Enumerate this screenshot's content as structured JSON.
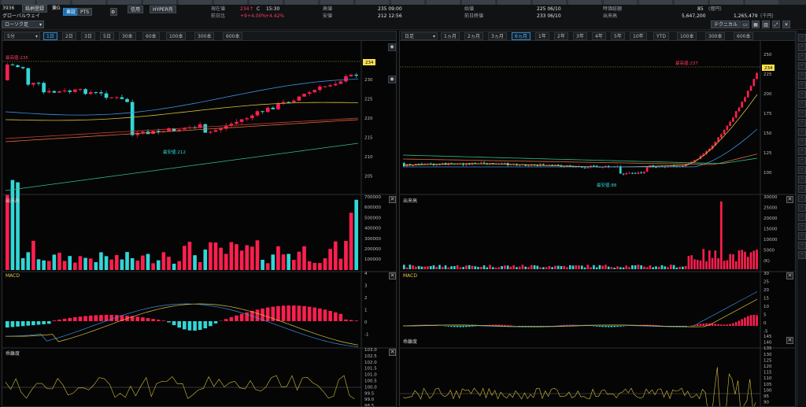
{
  "ticker": [
    "",
    "",
    "",
    "",
    "",
    "",
    "",
    "",
    "",
    "",
    "",
    "",
    "",
    "",
    "",
    "",
    "",
    "",
    "",
    "",
    "",
    ""
  ],
  "header": {
    "code": "3936",
    "name": "グローバルウェイ",
    "market_btn": "東G",
    "brand_btn": "銘柄登録",
    "tabs": [
      "東証",
      "PTS"
    ],
    "credit": "信用",
    "hyper": "HYPER売",
    "chart_type": "ローソク足",
    "labels": {
      "now": "現在値",
      "chg": "前日比",
      "high": "高値",
      "low": "安値",
      "open": "始値",
      "prev": "前日終値",
      "vol": "出来高",
      "val": "売買代金",
      "cap": "時価総額"
    },
    "values": {
      "now": "234",
      "now_mark": "↑",
      "c_label": "C",
      "time": "15:30",
      "chg": "+9",
      "chg_pct": "+4.00%",
      "chg_pct2": "+4.42%",
      "high": "235 09:00",
      "low": "212 12:56",
      "open": "225 06/10",
      "prev": "233 06/10",
      "vol": "5,647,200",
      "val": "1,265,479",
      "val_unit": "(千円)",
      "cap": "85",
      "cap_unit": "(億円)"
    },
    "technical": "テクニカル"
  },
  "left": {
    "interval": "5分",
    "tabs": [
      "1日",
      "2日",
      "3日",
      "5日",
      "30本",
      "60本",
      "100本",
      "300本",
      "600本"
    ],
    "active_tab": "1日",
    "price_tag": "234",
    "high_label": "最高値:235",
    "low_label": "最安値:212",
    "price_axis": [
      "230",
      "225",
      "220",
      "215",
      "210",
      "205"
    ],
    "vol_title": "出来高",
    "vol_axis": [
      "700000",
      "600000",
      "500000",
      "400000",
      "300000",
      "200000",
      "100000"
    ],
    "macd_title": "MACD",
    "macd_axis": [
      "4",
      "3",
      "2",
      "1",
      "0",
      "-1"
    ],
    "dev_title": "乖離度",
    "dev_axis": [
      "103.0",
      "102.5",
      "102.0",
      "101.5",
      "101.0",
      "100.5",
      "100.0",
      "99.5",
      "99.0",
      "98.5"
    ]
  },
  "right": {
    "interval": "日足",
    "tabs": [
      "1ヵ月",
      "2ヵ月",
      "3ヵ月",
      "6ヵ月",
      "1年",
      "2年",
      "3年",
      "4年",
      "5年",
      "10年",
      "YTD",
      "100本",
      "300本",
      "600本"
    ],
    "active_tab": "6ヵ月",
    "price_tag": "234",
    "high_label": "最高値:237",
    "low_label": "最安値:88",
    "price_axis": [
      "250",
      "225",
      "200",
      "175",
      "150",
      "125",
      "100"
    ],
    "vol_title": "出来高",
    "vol_axis": [
      "30000",
      "25000",
      "20000",
      "15000",
      "10000",
      "5000"
    ],
    "vol_unit": "(K)",
    "macd_title": "MACD",
    "macd_axis": [
      "30",
      "25",
      "20",
      "15",
      "10",
      "5",
      "0",
      "-5"
    ],
    "dev_title": "乖離度",
    "dev_axis": [
      "145",
      "140",
      "135",
      "130",
      "125",
      "120",
      "115",
      "110",
      "105",
      "100",
      "95",
      "90"
    ]
  },
  "colors": {
    "up": "#ff1f4f",
    "down": "#33d6d6",
    "accent": "#2a86cc",
    "tag": "#ffe14d"
  }
}
